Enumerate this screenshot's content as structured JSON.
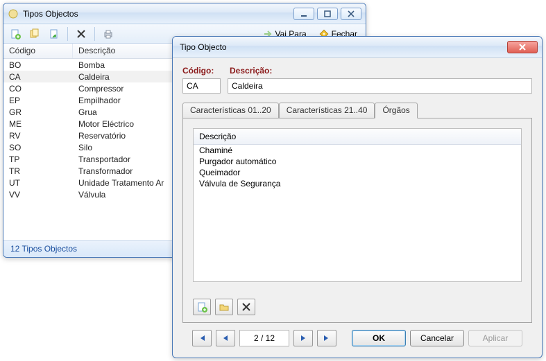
{
  "parent_window": {
    "title": "Tipos Objectos",
    "toolbar": {
      "vai_para": "Vai Para",
      "fechar": "Fechar"
    },
    "columns": {
      "codigo": "Código",
      "descricao": "Descrição"
    },
    "rows": [
      {
        "codigo": "BO",
        "descricao": "Bomba"
      },
      {
        "codigo": "CA",
        "descricao": "Caldeira"
      },
      {
        "codigo": "CO",
        "descricao": "Compressor"
      },
      {
        "codigo": "EP",
        "descricao": "Empilhador"
      },
      {
        "codigo": "GR",
        "descricao": "Grua"
      },
      {
        "codigo": "ME",
        "descricao": "Motor Eléctrico"
      },
      {
        "codigo": "RV",
        "descricao": "Reservatório"
      },
      {
        "codigo": "SO",
        "descricao": "Silo"
      },
      {
        "codigo": "TP",
        "descricao": "Transportador"
      },
      {
        "codigo": "TR",
        "descricao": "Transformador"
      },
      {
        "codigo": "UT",
        "descricao": "Unidade Tratamento Ar"
      },
      {
        "codigo": "VV",
        "descricao": "Válvula"
      }
    ],
    "selected_index": 1,
    "status": "12 Tipos Objectos"
  },
  "dialog": {
    "title": "Tipo Objecto",
    "labels": {
      "codigo": "Código:",
      "descricao": "Descrição:"
    },
    "values": {
      "codigo": "CA",
      "descricao": "Caldeira"
    },
    "tabs": {
      "t1": "Características 01..20",
      "t2": "Características 21..40",
      "t3": "Órgãos"
    },
    "active_tab": "t3",
    "orgaos": {
      "header": "Descrição",
      "items": [
        "Chaminé",
        "Purgador automático",
        "Queimador",
        "Válvula de Segurança"
      ]
    },
    "pager": "2 / 12",
    "buttons": {
      "ok": "OK",
      "cancelar": "Cancelar",
      "aplicar": "Aplicar"
    }
  }
}
